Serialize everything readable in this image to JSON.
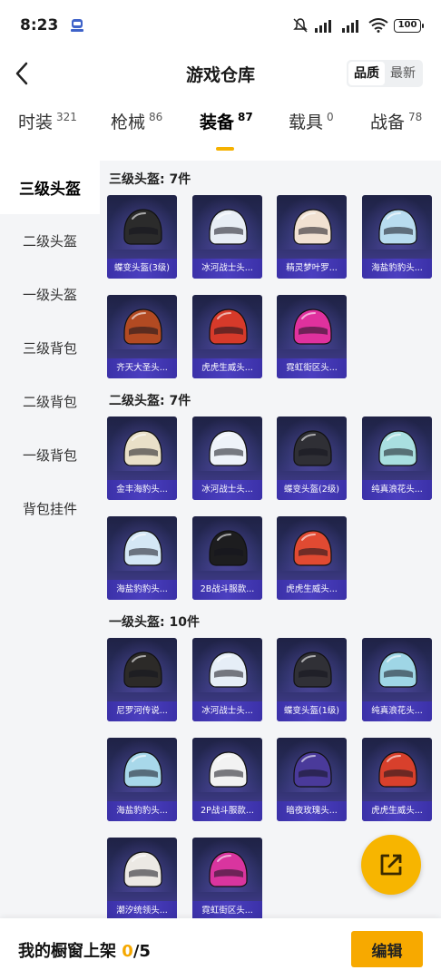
{
  "status_bar": {
    "time": "8:23",
    "battery": "100"
  },
  "header": {
    "title": "游戏仓库",
    "sort_options": [
      "品质",
      "最新"
    ]
  },
  "tabs": [
    {
      "label": "时装",
      "count": "321"
    },
    {
      "label": "枪械",
      "count": "86"
    },
    {
      "label": "装备",
      "count": "87"
    },
    {
      "label": "载具",
      "count": "0"
    },
    {
      "label": "战备",
      "count": "78"
    }
  ],
  "sidebar": {
    "items": [
      "三级头盔",
      "二级头盔",
      "一级头盔",
      "三级背包",
      "二级背包",
      "一级背包",
      "背包挂件"
    ]
  },
  "sections": [
    {
      "title": "三级头盔: 7件",
      "items": [
        {
          "name": "蝶变头盔(3级)",
          "color": "#2b2b2b"
        },
        {
          "name": "冰河战士头...",
          "color": "#e8eef5"
        },
        {
          "name": "精灵梦叶罗...",
          "color": "#f1e1d2"
        },
        {
          "name": "海盐豹豹头...",
          "color": "#b8dcef"
        },
        {
          "name": "齐天大圣头...",
          "color": "#b24a22"
        },
        {
          "name": "虎虎生威头...",
          "color": "#d63a2a"
        },
        {
          "name": "霓虹街区头...",
          "color": "#e0319e"
        }
      ]
    },
    {
      "title": "二级头盔: 7件",
      "items": [
        {
          "name": "金丰海豹头...",
          "color": "#e9e0c8"
        },
        {
          "name": "冰河战士头...",
          "color": "#eef3f9"
        },
        {
          "name": "蝶变头盔(2级)",
          "color": "#2f2f35"
        },
        {
          "name": "纯真浪花头...",
          "color": "#a9dfe0"
        },
        {
          "name": "海盐豹豹头...",
          "color": "#d4e7f5"
        },
        {
          "name": "2B战斗服款...",
          "color": "#1d1d1f"
        },
        {
          "name": "虎虎生威头...",
          "color": "#e14a32"
        }
      ]
    },
    {
      "title": "一级头盔: 10件",
      "items": [
        {
          "name": "尼罗河传说...",
          "color": "#2c2a28"
        },
        {
          "name": "冰河战士头...",
          "color": "#e6eef7"
        },
        {
          "name": "蝶变头盔(1级)",
          "color": "#303036"
        },
        {
          "name": "纯真浪花头...",
          "color": "#9fd6e6"
        },
        {
          "name": "海盐豹豹头...",
          "color": "#a8d8ea"
        },
        {
          "name": "2P战斗服款...",
          "color": "#f2f2f2"
        },
        {
          "name": "暗夜玫瑰头...",
          "color": "#4a3a9a"
        },
        {
          "name": "虎虎生威头...",
          "color": "#d8402c"
        },
        {
          "name": "潮汐统领头...",
          "color": "#ece9e4"
        },
        {
          "name": "霓虹街区头...",
          "color": "#d9359f"
        }
      ]
    }
  ],
  "bottom_bar": {
    "label": "我的橱窗上架 ",
    "current": "0",
    "total": "/5",
    "edit_label": "编辑"
  },
  "accent_color": "#f7b500"
}
